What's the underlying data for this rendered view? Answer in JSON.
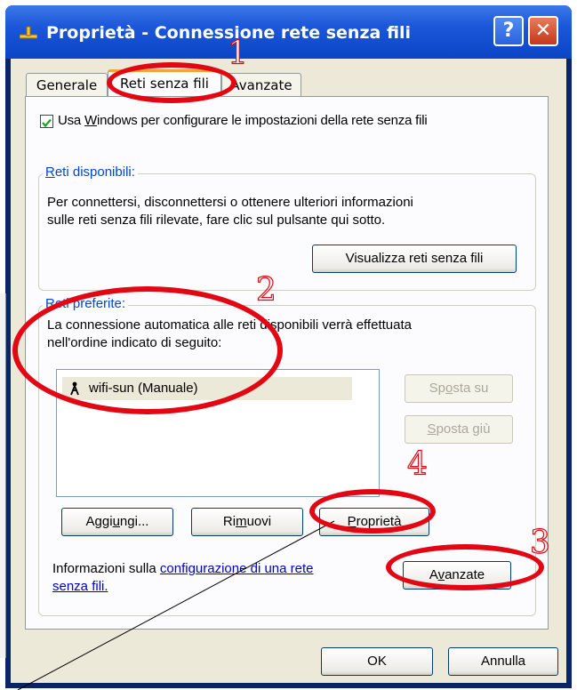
{
  "window": {
    "title": "Proprietà - Connessione rete senza fili",
    "help_label": "?",
    "close_label": "✕"
  },
  "tabs": [
    {
      "label": "Generale"
    },
    {
      "label": "Reti senza fili",
      "active": true
    },
    {
      "label": "Avanzate"
    }
  ],
  "use_windows_checkbox": {
    "checked": true,
    "label_pre": "Usa ",
    "label_key": "W",
    "label_post": "indows per configurare le impostazioni della rete senza fili"
  },
  "available": {
    "title_key": "R",
    "title_rest": "eti disponibili:",
    "text_line1": "Per connettersi, disconnettersi o ottenere ulteriori informazioni",
    "text_line2": "sulle reti senza fili rilevate, fare clic sul pulsante qui sotto.",
    "view_button": "Visualizza reti senza fili"
  },
  "preferred": {
    "title_key": "R",
    "title_rest": "eti preferite:",
    "text_line1": "La connessione automatica alle reti disponibili verrà effettuata",
    "text_line2": "nell'ordine indicato di seguito:",
    "networks": [
      {
        "name": "wifi-sun (Manuale)",
        "icon": "antenna-icon"
      }
    ],
    "move_up_pre": "Sp",
    "move_up_key": "o",
    "move_up_post": "sta su",
    "move_down_key": "S",
    "move_down_post": "posta giù",
    "add_pre": "Aggi",
    "add_key": "u",
    "add_post": "ngi...",
    "remove_pre": "Ri",
    "remove_key": "m",
    "remove_post": "uovi",
    "properties_key": "P",
    "properties_post": "roprietà"
  },
  "info": {
    "text_pre": "Informazioni sulla ",
    "link_part1": "configurazione di una rete",
    "link_part2": "senza fili.",
    "advanced_pre": "A",
    "advanced_key": "v",
    "advanced_post": "anzate"
  },
  "footer": {
    "ok": "OK",
    "cancel": "Annulla"
  },
  "annotations": [
    "1",
    "2",
    "3",
    "4"
  ],
  "colors": {
    "annotation": "#e30613",
    "titlebar": "#1c56d9",
    "tab_highlight": "#f3a33a"
  }
}
